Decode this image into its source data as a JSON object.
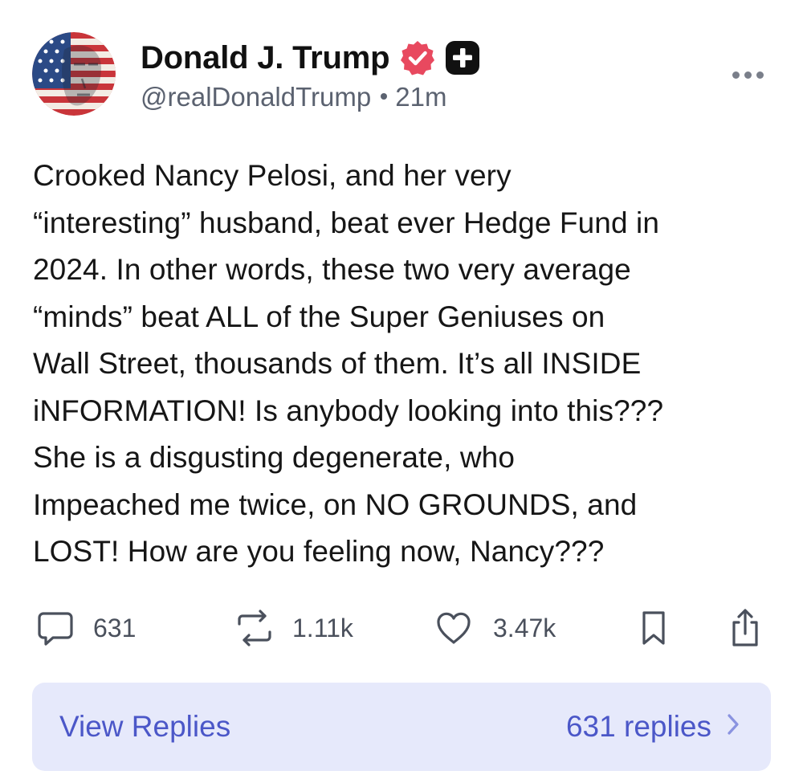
{
  "post": {
    "author": {
      "display_name": "Donald J. Trump",
      "handle": "@realDonaldTrump",
      "time_ago": "21m",
      "verified_badge_icon": "verified-check-icon",
      "plus_badge_icon": "plus-square-icon",
      "avatar_icon": "flag-portrait-avatar"
    },
    "more_icon": "more-horizontal-icon",
    "text": "Crooked Nancy Pelosi, and her very\n“interesting” husband, beat ever Hedge Fund in\n2024. In other words, these two very average\n“minds” beat ALL of the Super Geniuses on\nWall Street, thousands of them. It’s all INSIDE\niNFORMATION! Is anybody looking into this???\nShe is a disgusting degenerate, who\nImpeached me twice, on NO GROUNDS, and\nLOST! How are you feeling now, Nancy???",
    "actions": {
      "reply": {
        "icon": "comment-icon",
        "count": "631"
      },
      "repost": {
        "icon": "repost-icon",
        "count": "1.11k"
      },
      "like": {
        "icon": "heart-icon",
        "count": "3.47k"
      },
      "bookmark": {
        "icon": "bookmark-icon"
      },
      "share": {
        "icon": "share-icon"
      }
    },
    "view_replies": {
      "label": "View Replies",
      "count_text": "631 replies",
      "chevron_icon": "chevron-right-icon"
    }
  },
  "colors": {
    "verified_badge": "#e8495f",
    "plus_badge": "#111111",
    "muted_text": "#5b6270",
    "action_icon": "#4a505c",
    "replies_bg": "#e6e9fb",
    "replies_text": "#4b57c8"
  }
}
